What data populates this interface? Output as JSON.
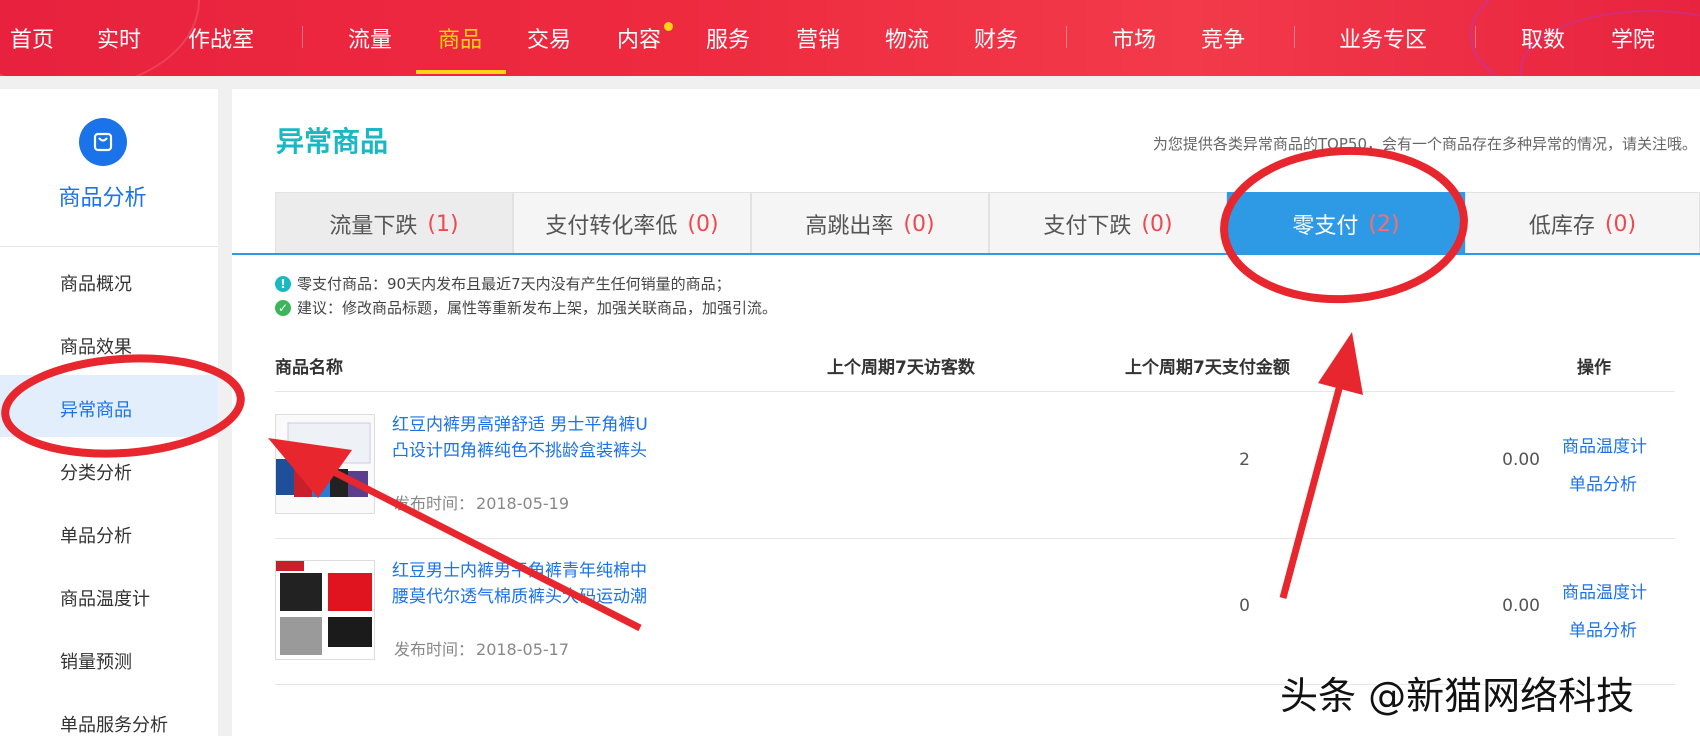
{
  "topnav": {
    "items": [
      {
        "label": "首页"
      },
      {
        "label": "实时"
      },
      {
        "label": "作战室"
      },
      {
        "label": "流量"
      },
      {
        "label": "商品"
      },
      {
        "label": "交易"
      },
      {
        "label": "内容"
      },
      {
        "label": "服务"
      },
      {
        "label": "营销"
      },
      {
        "label": "物流"
      },
      {
        "label": "财务"
      },
      {
        "label": "市场"
      },
      {
        "label": "竞争"
      },
      {
        "label": "业务专区"
      },
      {
        "label": "取数"
      },
      {
        "label": "学院"
      }
    ],
    "active": "商品",
    "colors": {
      "bar": "#e8223e",
      "active": "#ffd21a"
    }
  },
  "sidebar": {
    "title": "商品分析",
    "icon": "shopping-bag-icon",
    "items": [
      {
        "label": "商品概况"
      },
      {
        "label": "商品效果"
      },
      {
        "label": "异常商品"
      },
      {
        "label": "分类分析"
      },
      {
        "label": "单品分析"
      },
      {
        "label": "商品温度计"
      },
      {
        "label": "销量预测"
      },
      {
        "label": "单品服务分析"
      }
    ],
    "active": "异常商品"
  },
  "main": {
    "title": "异常商品",
    "note": "为您提供各类异常商品的TOP50，会有一个商品存在多种异常的情况，请关注哦。",
    "tabs": [
      {
        "label": "流量下跌",
        "count": "(1)"
      },
      {
        "label": "支付转化率低",
        "count": "(0)"
      },
      {
        "label": "高跳出率",
        "count": "(0)"
      },
      {
        "label": "支付下跌",
        "count": "(0)"
      },
      {
        "label": "零支付",
        "count": "(2)"
      },
      {
        "label": "低库存",
        "count": "(0)"
      }
    ],
    "active_tab": "零支付",
    "definition": "零支付商品：90天内发布且最近7天内没有产生任何销量的商品；",
    "suggestion": "建议：修改商品标题，属性等重新发布上架，加强关联商品，加强引流。",
    "table": {
      "headers": [
        "商品名称",
        "上个周期7天访客数",
        "上个周期7天支付金额",
        "操作"
      ],
      "rows": [
        {
          "name": "红豆内裤男高弹舒适 男士平角裤U凸设计四角裤纯色不挑龄盒装裤头",
          "date_label": "发布时间：",
          "date": "2018-05-19",
          "visitors": "2",
          "amount": "0.00",
          "op1": "商品温度计",
          "op2": "单品分析"
        },
        {
          "name": "红豆男士内裤男平角裤青年纯棉中腰莫代尔透气棉质裤头大码运动潮",
          "date_label": "发布时间：",
          "date": "2018-05-17",
          "visitors": "0",
          "amount": "0.00",
          "op1": "商品温度计",
          "op2": "单品分析"
        }
      ]
    }
  },
  "watermark": "头条 @新猫网络科技",
  "annotation_color": "#e8262d"
}
